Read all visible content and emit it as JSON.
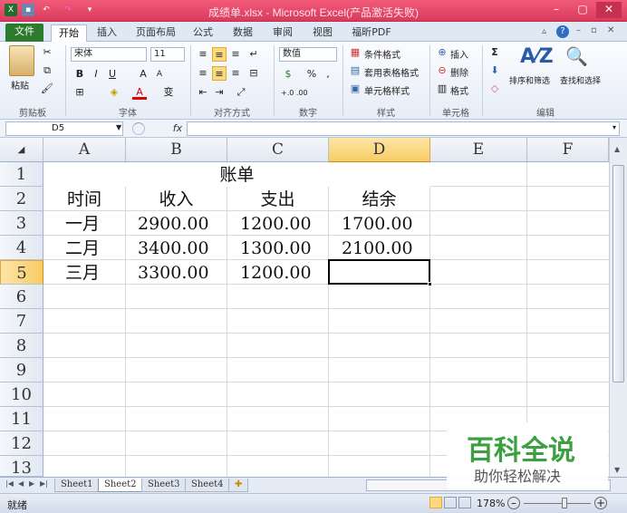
{
  "window": {
    "title": "成绩单.xlsx - Microsoft Excel(产品激活失败)",
    "controls": [
      "–",
      "▢",
      "✕"
    ],
    "accent": "#e2446a"
  },
  "tabs": [
    {
      "label": "文件",
      "kind": "file"
    },
    {
      "label": "开始",
      "kind": "active"
    },
    {
      "label": "插入"
    },
    {
      "label": "页面布局"
    },
    {
      "label": "公式"
    },
    {
      "label": "数据"
    },
    {
      "label": "审阅"
    },
    {
      "label": "视图"
    },
    {
      "label": "福昕PDF"
    }
  ],
  "ribbon": {
    "clipboard": {
      "paste": "粘贴",
      "label": "剪贴板"
    },
    "font": {
      "name": "宋体",
      "size": "11",
      "bold": "B",
      "italic": "I",
      "underline": "U",
      "grow": "A",
      "shrink": "A",
      "font_color": "A",
      "phonetic": "变",
      "label": "字体"
    },
    "alignment": {
      "label": "对齐方式"
    },
    "number": {
      "format": "数值",
      "percent": "%",
      "comma": ",",
      "inc": "+.0 .00",
      "dec": ".00 +.0",
      "label": "数字"
    },
    "styles": {
      "conditional": "条件格式",
      "table": "套用表格格式",
      "cell": "单元格样式",
      "label": "样式"
    },
    "cells": {
      "insert": "插入",
      "delete": "删除",
      "format": "格式",
      "label": "单元格"
    },
    "editing": {
      "sum": "Σ",
      "sort": "排序和筛选",
      "find": "查找和选择",
      "label": "编辑"
    }
  },
  "formula_bar": {
    "name_box": "D5",
    "fx": "fx",
    "content": ""
  },
  "columns": [
    "A",
    "B",
    "C",
    "D",
    "E",
    "F"
  ],
  "selected_column": "D",
  "rows": [
    "1",
    "2",
    "3",
    "4",
    "5",
    "6",
    "7",
    "8",
    "9",
    "10",
    "11",
    "12",
    "13"
  ],
  "selected_row": "5",
  "sheet": {
    "title": "账单",
    "headers": [
      "时间",
      "收入",
      "支出",
      "结余"
    ],
    "data": [
      [
        "一月",
        "2900.00",
        "1200.00",
        "1700.00"
      ],
      [
        "二月",
        "3400.00",
        "1300.00",
        "2100.00"
      ],
      [
        "三月",
        "3300.00",
        "1200.00",
        ""
      ]
    ]
  },
  "sheet_tabs": [
    "Sheet1",
    "Sheet2",
    "Sheet3",
    "Sheet4"
  ],
  "active_sheet": "Sheet2",
  "status": {
    "ready": "就绪",
    "zoom": "178%"
  },
  "watermark": {
    "brand": "百科全说",
    "slogan": "助你轻松解决",
    "color": "#3aa040"
  }
}
